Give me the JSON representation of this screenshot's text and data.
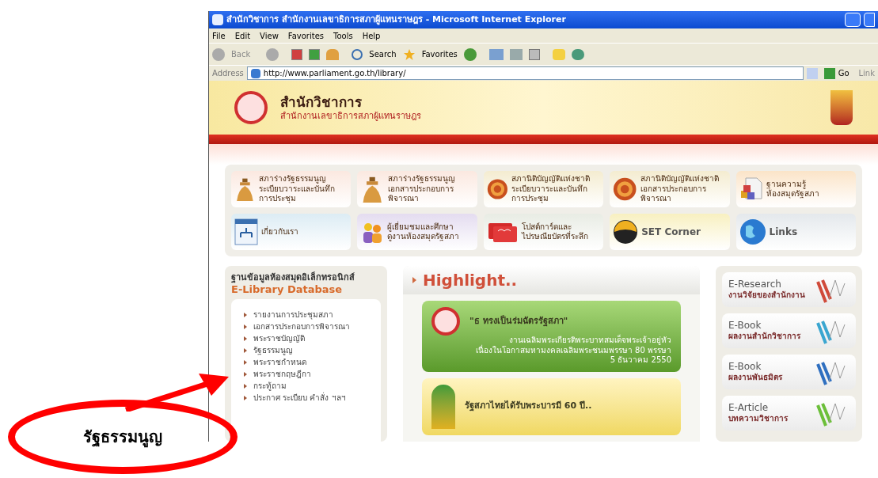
{
  "window": {
    "title": "สำนักวิชาการ สำนักงานเลขาธิการสภาผู้แทนราษฎร - Microsoft Internet Explorer"
  },
  "menu": [
    "File",
    "Edit",
    "View",
    "Favorites",
    "Tools",
    "Help"
  ],
  "toolbar": {
    "back": "Back",
    "search": "Search",
    "favorites": "Favorites"
  },
  "address": {
    "label": "Address",
    "value": "http://www.parliament.go.th/library/",
    "go": "Go",
    "links": "Link"
  },
  "site": {
    "title": "สำนักวิชาการ",
    "subtitle": "สำนักงานเลขาธิการสภาผู้แทนราษฎร"
  },
  "tiles": [
    {
      "kind": "figure",
      "lines": [
        "สภาร่างรัฐธรรมนูญ",
        "ระเบียบวาระและบันทึกการประชุม"
      ]
    },
    {
      "kind": "figure",
      "lines": [
        "สภาร่างรัฐธรรมนูญ",
        "เอกสารประกอบการพิจารณา"
      ]
    },
    {
      "kind": "seal",
      "lines": [
        "สภานิติบัญญัติแห่งชาติ",
        "ระเบียบวาระและบันทึกการประชุม"
      ]
    },
    {
      "kind": "seal",
      "lines": [
        "สภานิติบัญญัติแห่งชาติ",
        "เอกสารประกอบการพิจารณา"
      ]
    },
    {
      "kind": "doc",
      "lines": [
        "ฐานความรู้",
        "ห้องสมุดรัฐสภา"
      ]
    },
    {
      "kind": "chart",
      "lines": [
        "เกี่ยวกับเรา"
      ]
    },
    {
      "kind": "people",
      "lines": [
        "ผู้เยี่ยมชมและศึกษา",
        "ดูงานห้องสมุดรัฐสภา"
      ]
    },
    {
      "kind": "card",
      "lines": [
        "โปสต์การ์ดและ",
        "ไปรษณียบัตรที่ระลึก"
      ]
    },
    {
      "kind": "set",
      "lines": [
        "SET Corner"
      ]
    },
    {
      "kind": "globe",
      "lines": [
        "Links"
      ]
    }
  ],
  "elibrary": {
    "title": "ฐานข้อมูลห้องสมุดอิเล็กทรอนิกส์",
    "subtitle": "E-Library Database",
    "items": [
      "รายงานการประชุมสภา",
      "เอกสารประกอบการพิจารณา",
      "พระราชบัญญัติ",
      "รัฐธรรมนูญ",
      "พระราชกำหนด",
      "พระราชกฤษฎีกา",
      "กระทู้ถาม",
      "ประกาศ ระเบียบ คำสั่ง ฯลฯ"
    ]
  },
  "highlight": {
    "title": "Highlight..",
    "cards": [
      {
        "kind": "green",
        "heading": "\"ธ ทรงเป็นร่มฉัตรรัฐสภา\"",
        "lines": [
          "งานเฉลิมพระเกียรติพระบาทสมเด็จพระเจ้าอยู่หัว",
          "เนื่องในโอกาสมหามงคลเฉลิมพระชนมพรรษา 80 พรรษา",
          "5 ธันวาคม 2550"
        ]
      },
      {
        "kind": "yellow",
        "heading": "รัฐสภาไทยได้รับพระบารมี 60 ปี.."
      }
    ]
  },
  "resources": [
    {
      "title": "E-Research",
      "subtitle": "งานวิจัยของสำนักงาน",
      "color": "#d04a3a"
    },
    {
      "title": "E-Book",
      "subtitle": "ผลงานสำนักวิชาการ",
      "color": "#3aa6d0"
    },
    {
      "title": "E-Book",
      "subtitle": "ผลงานพันธมิตร",
      "color": "#2f6fc0"
    },
    {
      "title": "E-Article",
      "subtitle": "บทความวิชาการ",
      "color": "#6cbf3a"
    }
  ],
  "callout": {
    "text": "รัฐธรรมนูญ"
  }
}
